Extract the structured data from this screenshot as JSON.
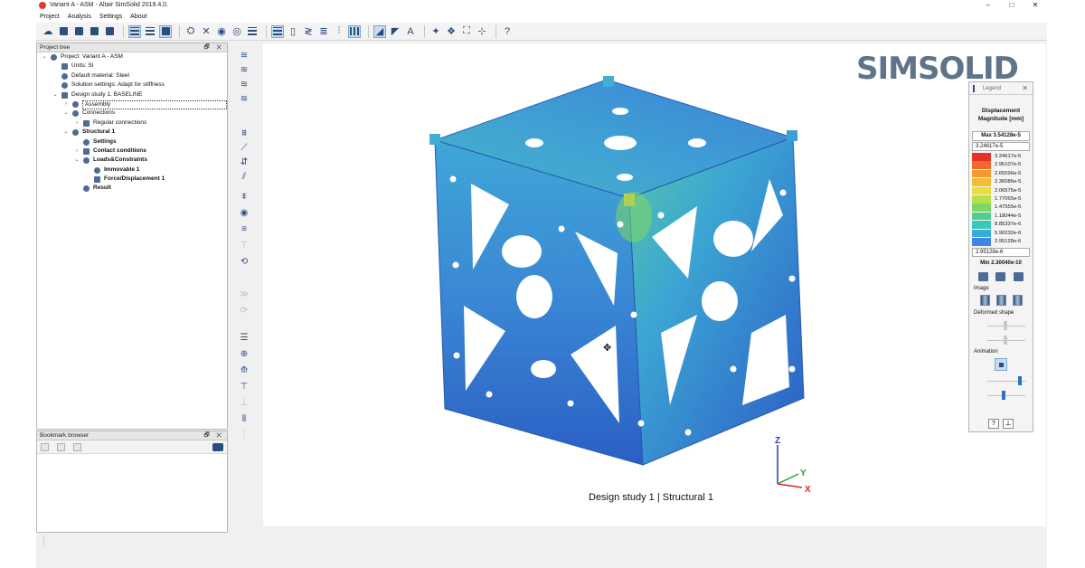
{
  "window": {
    "title": "Variant A - ASM - Altair SimSolid 2019.4.0.",
    "controls": {
      "minimize": "–",
      "maximize": "□",
      "close": "✕"
    }
  },
  "menu": [
    "Project",
    "Analysis",
    "Settings",
    "About"
  ],
  "project_tree": {
    "header": "Project tree",
    "header_controls": "🗗 ✕",
    "items": [
      {
        "label": "Project: Variant A - ASM",
        "level": 0,
        "twisty": "v",
        "icon": "project-icon"
      },
      {
        "label": "Units: SI",
        "level": 1,
        "twisty": "",
        "icon": "units-icon"
      },
      {
        "label": "Default material: Steel",
        "level": 1,
        "twisty": "",
        "icon": "material-icon"
      },
      {
        "label": "Solution settings: Adapt for stiffness",
        "level": 1,
        "twisty": "",
        "icon": "settings-gear-icon"
      },
      {
        "label": "Design study 1. BASELINE",
        "level": 1,
        "twisty": "v",
        "icon": "design-study-icon"
      },
      {
        "label": "Assembly",
        "level": 2,
        "twisty": ">",
        "icon": "assembly-icon",
        "selected": true
      },
      {
        "label": "Connections",
        "level": 2,
        "twisty": "v",
        "icon": "connections-icon"
      },
      {
        "label": "Regular connections",
        "level": 3,
        "twisty": ">",
        "icon": "regular-connections-icon"
      },
      {
        "label": "Structural  1",
        "level": 2,
        "twisty": "v",
        "icon": "structural-icon",
        "bold": true
      },
      {
        "label": "Settings",
        "level": 3,
        "twisty": "",
        "icon": "settings-gear-icon",
        "bold": true
      },
      {
        "label": "Contact conditions",
        "level": 3,
        "twisty": ">",
        "icon": "contact-icon",
        "bold": true
      },
      {
        "label": "Loads&Constraints",
        "level": 3,
        "twisty": "v",
        "icon": "loads-icon",
        "bold": true
      },
      {
        "label": "Immovable 1",
        "level": 4,
        "twisty": "",
        "icon": "immovable-icon",
        "bold": true
      },
      {
        "label": "Force/Displacement 1",
        "level": 4,
        "twisty": "",
        "icon": "force-icon",
        "bold": true
      },
      {
        "label": "Result",
        "level": 3,
        "twisty": "",
        "icon": "result-icon",
        "bold": true
      }
    ]
  },
  "bookmark_browser": {
    "header": "Bookmark browser",
    "header_controls": "🗗 ✕"
  },
  "toolbar_icons": [
    "cloud-open-icon",
    "new-document-icon",
    "open-folder-icon",
    "import-folder-icon",
    "save-icon",
    "list-view-icon",
    "split-view-icon",
    "screen-capture-icon",
    "geometry-icon",
    "connect-icon",
    "view-eye-icon",
    "hide-eye-icon",
    "report-icon",
    "spring-icon",
    "part-icon",
    "spring-small-icon",
    "stack-icon",
    "bolt-icon",
    "mesh-icon",
    "select-part-icon",
    "select-group-icon",
    "measure-icon",
    "explode-icon",
    "color-icon",
    "fit-icon",
    "reset-view-icon",
    "help-icon"
  ],
  "viewport": {
    "brand": "SIMSOLID",
    "study_label": "Design study 1 | Structural  1",
    "cursor_icon": "move-cursor-icon"
  },
  "legend": {
    "title": "Legend",
    "type": "Displacement Magnitude [mm]",
    "max_label": "Max  3.54128e-5",
    "upper_value": "3.24617e-5",
    "lower_value": "2.95128e-6",
    "min_label": "Min  2.30040e-10",
    "scale": [
      {
        "value": "3.24617e-5",
        "color": "#e8302b"
      },
      {
        "value": "2.95107e-5",
        "color": "#ee6a2a"
      },
      {
        "value": "2.65596e-5",
        "color": "#f29a2e"
      },
      {
        "value": "2.36086e-5",
        "color": "#f4bd33"
      },
      {
        "value": "2.06575e-5",
        "color": "#e8de3c"
      },
      {
        "value": "1.77065e-5",
        "color": "#b9e04a"
      },
      {
        "value": "1.47555e-5",
        "color": "#7fd763"
      },
      {
        "value": "1.18044e-5",
        "color": "#4fcf8d"
      },
      {
        "value": "8.85337e-6",
        "color": "#3cc6b8"
      },
      {
        "value": "5.90232e-6",
        "color": "#3aaad8"
      },
      {
        "value": "2.95128e-6",
        "color": "#3d86e3"
      }
    ],
    "sections": {
      "image": "Image",
      "deformed_shape": "Deformed shape",
      "animation": "Animation"
    },
    "footer": {
      "help": "?",
      "probe": "⊥"
    }
  },
  "triad": {
    "z": "Z",
    "y": "Y",
    "x": "X"
  }
}
